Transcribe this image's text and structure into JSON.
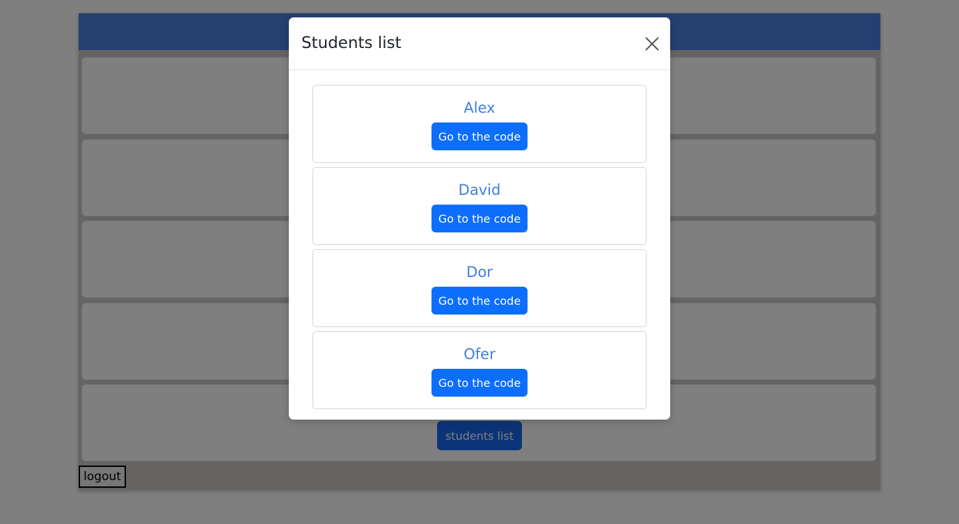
{
  "background_page": {
    "students_list_button": "students list",
    "logout_button": "logout"
  },
  "modal": {
    "title": "Students list",
    "close_icon": "close-icon",
    "students": [
      {
        "name": "Alex",
        "button": "Go to the code"
      },
      {
        "name": "David",
        "button": "Go to the code"
      },
      {
        "name": "Dor",
        "button": "Go to the code"
      },
      {
        "name": "Ofer",
        "button": "Go to the code"
      }
    ]
  },
  "colors": {
    "header_blue": "#4a7ee0",
    "primary_button": "#0d6efd",
    "student_name": "#3f7de0",
    "backdrop": "rgba(0,0,0,0.5)"
  }
}
